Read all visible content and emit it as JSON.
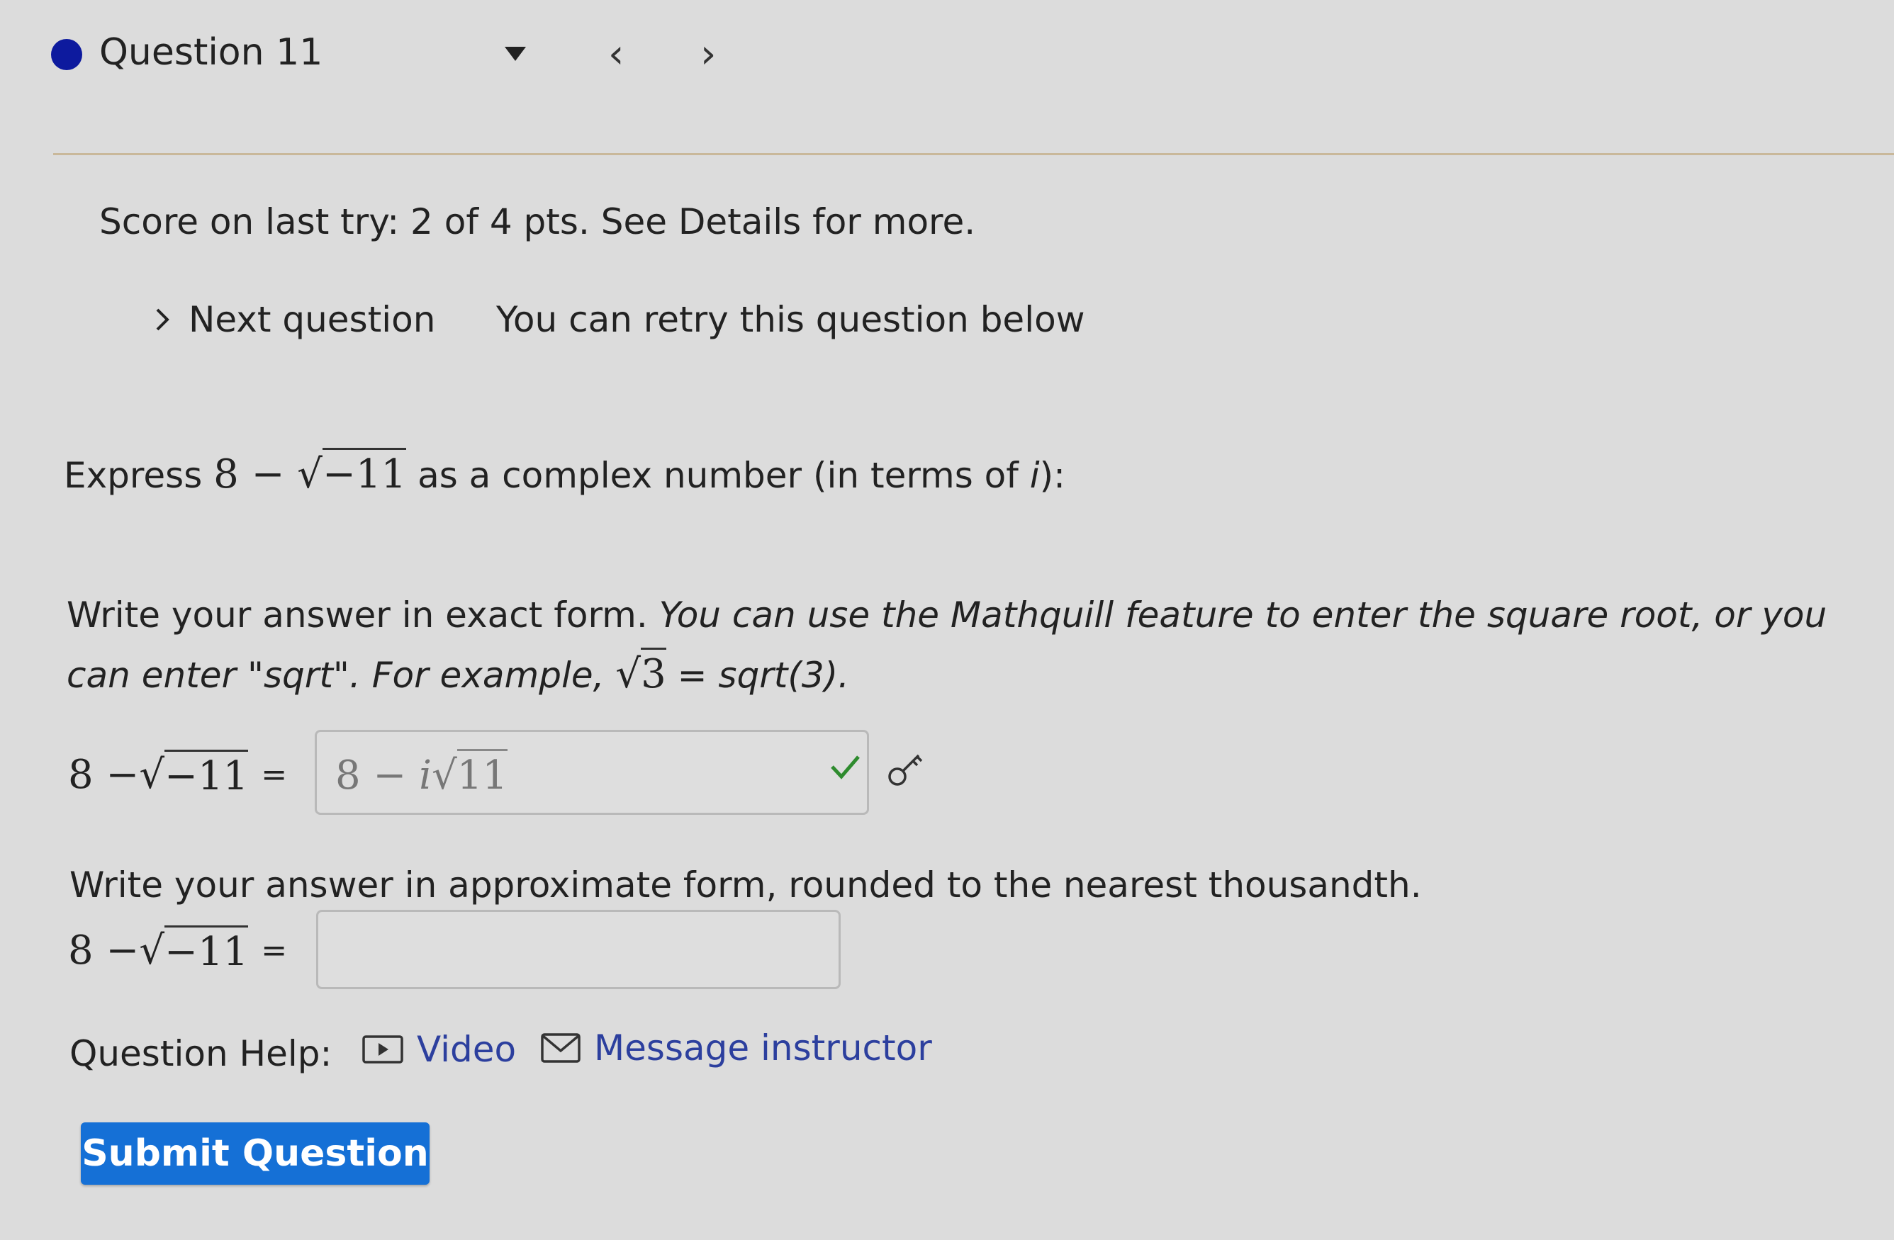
{
  "header": {
    "question_title": "Question 11",
    "status_color": "#0d1a9e"
  },
  "score": {
    "prefix": "Score on last try: ",
    "value": "2 of 4 pts",
    "suffix": ". See Details for more."
  },
  "nav": {
    "next_question_label": "Next question",
    "retry_text": "You can retry this question below"
  },
  "prompt": {
    "lead": "Express ",
    "expr_num": "8 − ",
    "expr_radicand": "−11",
    "tail_a": " as a complex number (in terms of ",
    "tail_var": "i",
    "tail_b": "):"
  },
  "instructions": {
    "plain": "Write your answer in exact form. ",
    "italic_a": "You can use the Mathquill feature to enter the square root, or you can enter \"sqrt\". For example, ",
    "example_radicand": "3",
    "italic_b": " = sqrt(3)."
  },
  "exact_answer": {
    "lhs_num": "8 − ",
    "lhs_radicand": "−11",
    "equals": "=",
    "value_prefix": "8 − ",
    "value_var": "i",
    "value_radicand": "11",
    "status": "correct",
    "accent_color": "#2e8b2e"
  },
  "approx_answer": {
    "instruction": "Write your answer in approximate form, rounded to the nearest thousandth.",
    "lhs_num": "8 − ",
    "lhs_radicand": "−11",
    "equals": "=",
    "value": ""
  },
  "help": {
    "label": "Question Help:",
    "video_label": "Video",
    "message_label": "Message instructor",
    "link_color": "#2c3f9e"
  },
  "submit": {
    "label": "Submit Question",
    "color": "#1570d6"
  }
}
